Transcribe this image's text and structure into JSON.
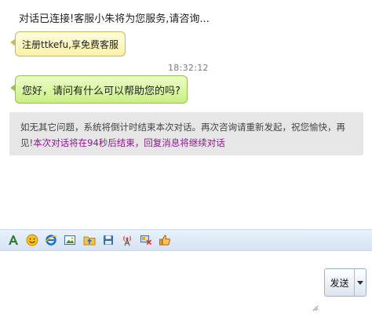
{
  "status_line": "对话已连接!客服小朱将为您服务,请咨询...",
  "messages": [
    {
      "text": "注册ttkefu,享免费客服"
    },
    {
      "text": "您好，请问有什么可以帮助您的吗?"
    }
  ],
  "timestamp": "18:32:12",
  "notice": {
    "text": "如无其它问题，系统将倒计时结束本次对话。再次咨询请重新发起，祝您愉快，再见!",
    "highlight": "本次对话将在94秒后结束，回复消息将继续对话"
  },
  "toolbar": {
    "icons": [
      "font-icon",
      "emoji-icon",
      "browser-icon",
      "image-icon",
      "folder-upload-icon",
      "save-icon",
      "remote-assist-icon",
      "screenshot-icon",
      "like-icon"
    ]
  },
  "send_button": {
    "label": "发送"
  }
}
